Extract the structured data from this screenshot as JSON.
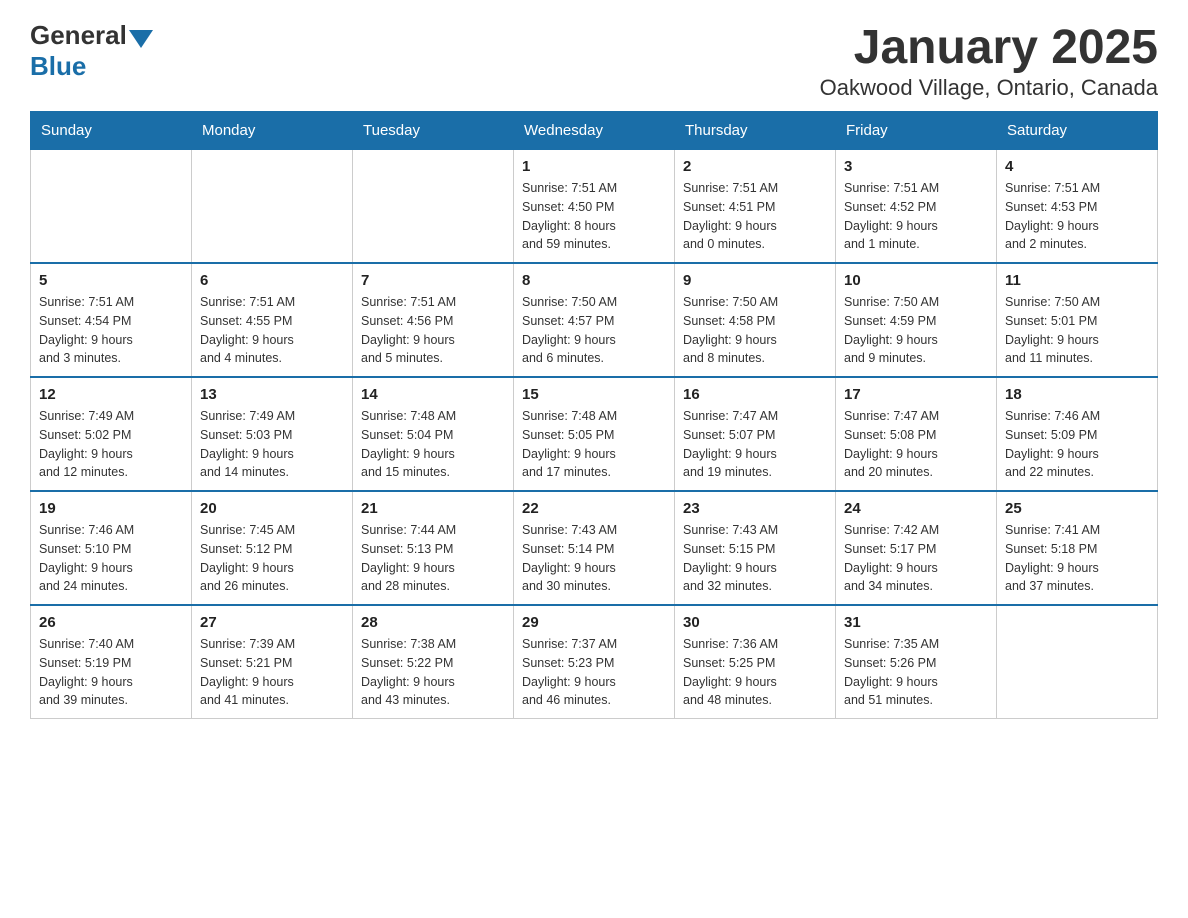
{
  "header": {
    "logo": {
      "general": "General",
      "blue": "Blue"
    },
    "title": "January 2025",
    "subtitle": "Oakwood Village, Ontario, Canada"
  },
  "calendar": {
    "days_of_week": [
      "Sunday",
      "Monday",
      "Tuesday",
      "Wednesday",
      "Thursday",
      "Friday",
      "Saturday"
    ],
    "weeks": [
      [
        {
          "day": "",
          "info": ""
        },
        {
          "day": "",
          "info": ""
        },
        {
          "day": "",
          "info": ""
        },
        {
          "day": "1",
          "info": "Sunrise: 7:51 AM\nSunset: 4:50 PM\nDaylight: 8 hours\nand 59 minutes."
        },
        {
          "day": "2",
          "info": "Sunrise: 7:51 AM\nSunset: 4:51 PM\nDaylight: 9 hours\nand 0 minutes."
        },
        {
          "day": "3",
          "info": "Sunrise: 7:51 AM\nSunset: 4:52 PM\nDaylight: 9 hours\nand 1 minute."
        },
        {
          "day": "4",
          "info": "Sunrise: 7:51 AM\nSunset: 4:53 PM\nDaylight: 9 hours\nand 2 minutes."
        }
      ],
      [
        {
          "day": "5",
          "info": "Sunrise: 7:51 AM\nSunset: 4:54 PM\nDaylight: 9 hours\nand 3 minutes."
        },
        {
          "day": "6",
          "info": "Sunrise: 7:51 AM\nSunset: 4:55 PM\nDaylight: 9 hours\nand 4 minutes."
        },
        {
          "day": "7",
          "info": "Sunrise: 7:51 AM\nSunset: 4:56 PM\nDaylight: 9 hours\nand 5 minutes."
        },
        {
          "day": "8",
          "info": "Sunrise: 7:50 AM\nSunset: 4:57 PM\nDaylight: 9 hours\nand 6 minutes."
        },
        {
          "day": "9",
          "info": "Sunrise: 7:50 AM\nSunset: 4:58 PM\nDaylight: 9 hours\nand 8 minutes."
        },
        {
          "day": "10",
          "info": "Sunrise: 7:50 AM\nSunset: 4:59 PM\nDaylight: 9 hours\nand 9 minutes."
        },
        {
          "day": "11",
          "info": "Sunrise: 7:50 AM\nSunset: 5:01 PM\nDaylight: 9 hours\nand 11 minutes."
        }
      ],
      [
        {
          "day": "12",
          "info": "Sunrise: 7:49 AM\nSunset: 5:02 PM\nDaylight: 9 hours\nand 12 minutes."
        },
        {
          "day": "13",
          "info": "Sunrise: 7:49 AM\nSunset: 5:03 PM\nDaylight: 9 hours\nand 14 minutes."
        },
        {
          "day": "14",
          "info": "Sunrise: 7:48 AM\nSunset: 5:04 PM\nDaylight: 9 hours\nand 15 minutes."
        },
        {
          "day": "15",
          "info": "Sunrise: 7:48 AM\nSunset: 5:05 PM\nDaylight: 9 hours\nand 17 minutes."
        },
        {
          "day": "16",
          "info": "Sunrise: 7:47 AM\nSunset: 5:07 PM\nDaylight: 9 hours\nand 19 minutes."
        },
        {
          "day": "17",
          "info": "Sunrise: 7:47 AM\nSunset: 5:08 PM\nDaylight: 9 hours\nand 20 minutes."
        },
        {
          "day": "18",
          "info": "Sunrise: 7:46 AM\nSunset: 5:09 PM\nDaylight: 9 hours\nand 22 minutes."
        }
      ],
      [
        {
          "day": "19",
          "info": "Sunrise: 7:46 AM\nSunset: 5:10 PM\nDaylight: 9 hours\nand 24 minutes."
        },
        {
          "day": "20",
          "info": "Sunrise: 7:45 AM\nSunset: 5:12 PM\nDaylight: 9 hours\nand 26 minutes."
        },
        {
          "day": "21",
          "info": "Sunrise: 7:44 AM\nSunset: 5:13 PM\nDaylight: 9 hours\nand 28 minutes."
        },
        {
          "day": "22",
          "info": "Sunrise: 7:43 AM\nSunset: 5:14 PM\nDaylight: 9 hours\nand 30 minutes."
        },
        {
          "day": "23",
          "info": "Sunrise: 7:43 AM\nSunset: 5:15 PM\nDaylight: 9 hours\nand 32 minutes."
        },
        {
          "day": "24",
          "info": "Sunrise: 7:42 AM\nSunset: 5:17 PM\nDaylight: 9 hours\nand 34 minutes."
        },
        {
          "day": "25",
          "info": "Sunrise: 7:41 AM\nSunset: 5:18 PM\nDaylight: 9 hours\nand 37 minutes."
        }
      ],
      [
        {
          "day": "26",
          "info": "Sunrise: 7:40 AM\nSunset: 5:19 PM\nDaylight: 9 hours\nand 39 minutes."
        },
        {
          "day": "27",
          "info": "Sunrise: 7:39 AM\nSunset: 5:21 PM\nDaylight: 9 hours\nand 41 minutes."
        },
        {
          "day": "28",
          "info": "Sunrise: 7:38 AM\nSunset: 5:22 PM\nDaylight: 9 hours\nand 43 minutes."
        },
        {
          "day": "29",
          "info": "Sunrise: 7:37 AM\nSunset: 5:23 PM\nDaylight: 9 hours\nand 46 minutes."
        },
        {
          "day": "30",
          "info": "Sunrise: 7:36 AM\nSunset: 5:25 PM\nDaylight: 9 hours\nand 48 minutes."
        },
        {
          "day": "31",
          "info": "Sunrise: 7:35 AM\nSunset: 5:26 PM\nDaylight: 9 hours\nand 51 minutes."
        },
        {
          "day": "",
          "info": ""
        }
      ]
    ]
  }
}
